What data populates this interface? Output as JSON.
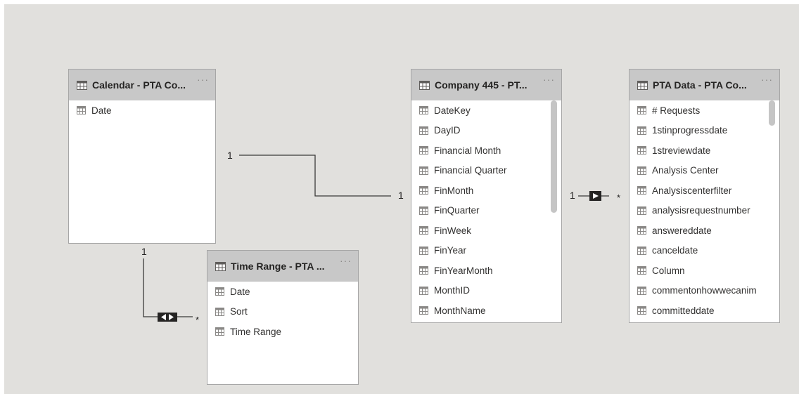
{
  "tables": {
    "calendar": {
      "title": "Calendar - PTA Co...",
      "fields": [
        "Date"
      ]
    },
    "time_range": {
      "title": "Time Range - PTA ...",
      "fields": [
        "Date",
        "Sort",
        "Time Range"
      ]
    },
    "company445": {
      "title": "Company 445 - PT...",
      "fields": [
        "DateKey",
        "DayID",
        "Financial Month",
        "Financial Quarter",
        "FinMonth",
        "FinQuarter",
        "FinWeek",
        "FinYear",
        "FinYearMonth",
        "MonthID",
        "MonthName"
      ]
    },
    "pta_data": {
      "title": "PTA Data - PTA Co...",
      "fields": [
        "# Requests",
        "1stinprogressdate",
        "1streviewdate",
        "Analysis Center",
        "Analysiscenterfilter",
        "analysisrequestnumber",
        "answereddate",
        "canceldate",
        "Column",
        "commentonhowwecanim",
        "committeddate"
      ]
    }
  },
  "relationships": {
    "calendar_company": {
      "from_card": "1",
      "to_card": "1"
    },
    "calendar_timerange": {
      "from_card": "1",
      "to_card": "*"
    },
    "company_pta": {
      "from_card": "1",
      "to_card": "*"
    }
  },
  "menu_glyph": "···",
  "colors": {
    "canvas": "#e1e0dd",
    "header": "#c8c8c8",
    "line": "#3b3a39"
  }
}
